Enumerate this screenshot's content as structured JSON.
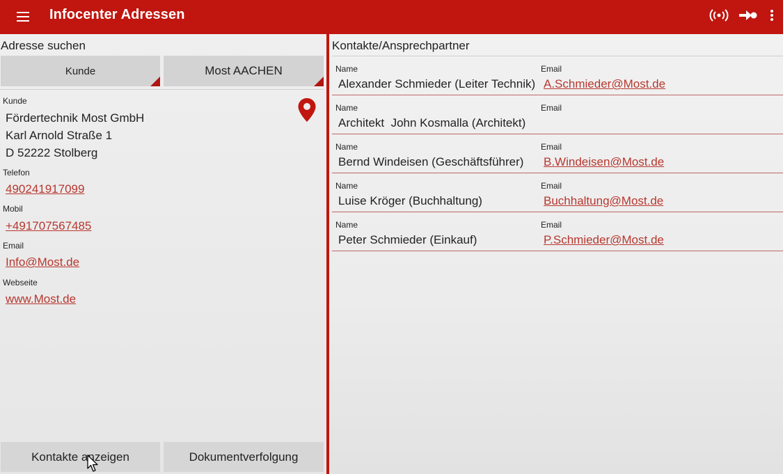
{
  "appbar": {
    "title": "Infocenter Adressen",
    "icons": [
      "menu-icon",
      "wifi-broadcast-icon",
      "sync-arrow-icon",
      "overflow-menu-icon"
    ]
  },
  "colors": {
    "accent": "#c0160f",
    "link": "#b8372f",
    "spinner_bg": "#d3d3d3"
  },
  "left": {
    "section_title": "Adresse suchen",
    "spinner_type": "Kunde",
    "spinner_value": "Most AACHEN",
    "kunde_label": "Kunde",
    "kunde_line1": "Fördertechnik Most GmbH",
    "kunde_line2": "Karl Arnold Straße 1",
    "kunde_line3": "D 52222 Stolberg",
    "telefon_label": "Telefon",
    "telefon_value": "490241917099",
    "mobil_label": "Mobil",
    "mobil_value": "+491707567485",
    "email_label": "Email",
    "email_value": "Info@Most.de",
    "webseite_label": "Webseite",
    "webseite_value": "www.Most.de",
    "btn_kontakte": "Kontakte anzeigen",
    "btn_dokumente": "Dokumentverfolgung"
  },
  "right": {
    "section_title": "Kontakte/Ansprechpartner",
    "name_label": "Name",
    "email_label": "Email",
    "contacts": [
      {
        "name": "Alexander Schmieder (Leiter Technik)",
        "email": "A.Schmieder@Most.de"
      },
      {
        "name": "Architekt  John Kosmalla (Architekt)",
        "email": ""
      },
      {
        "name": "Bernd Windeisen (Geschäftsführer)",
        "email": "B.Windeisen@Most.de"
      },
      {
        "name": "Luise Kröger (Buchhaltung)",
        "email": "Buchhaltung@Most.de"
      },
      {
        "name": "Peter Schmieder (Einkauf)",
        "email": "P.Schmieder@Most.de"
      }
    ]
  }
}
